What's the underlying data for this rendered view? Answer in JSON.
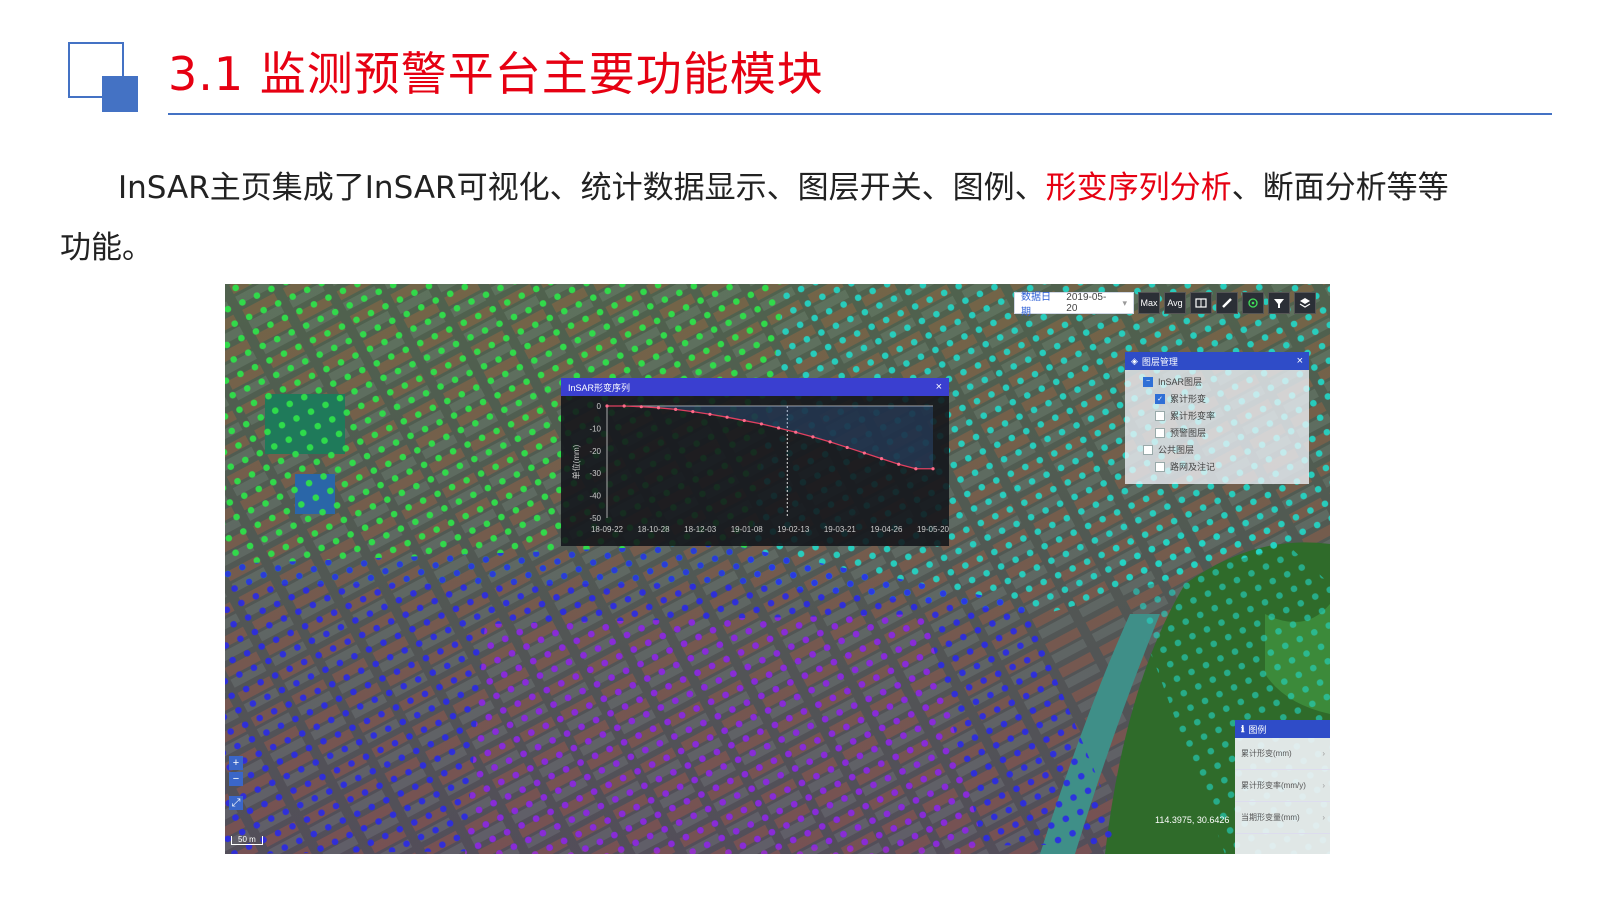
{
  "slide": {
    "title": "3.1 监测预警平台主要功能模块",
    "para_before": "InSAR主页集成了InSAR可视化、统计数据显示、图层开关、图例、",
    "para_highlight": "形变序列分析",
    "para_after": "、断面分析等等功能。"
  },
  "toolbar": {
    "date_label": "数据日期",
    "date_value": "2019-05-20",
    "buttons": [
      "Max",
      "Avg"
    ]
  },
  "layer_panel": {
    "title": "图层管理",
    "items": [
      {
        "label": "InSAR图层",
        "checked": false
      },
      {
        "label": "累计形变",
        "checked": true
      },
      {
        "label": "累计形变率",
        "checked": false
      },
      {
        "label": "预警图层",
        "checked": false
      },
      {
        "label": "公共图层",
        "checked": false
      },
      {
        "label": "路网及注记",
        "checked": false
      }
    ]
  },
  "chart_window": {
    "title": "InSAR形变序列"
  },
  "chart_data": {
    "type": "line",
    "title": "",
    "xlabel": "",
    "ylabel": "单位(mm)",
    "x_tick_labels": [
      "18-09-22",
      "18-10-28",
      "18-12-03",
      "19-01-08",
      "19-02-13",
      "19-03-21",
      "19-04-26",
      "19-05-20"
    ],
    "y_ticks": [
      0,
      -10,
      -20,
      -30,
      -40,
      -50
    ],
    "ylim": [
      -50,
      0
    ],
    "series": [
      {
        "values": [
          0,
          0,
          -0.3,
          -0.8,
          -1.5,
          -2.5,
          -3.7,
          -5.0,
          -6.5,
          -8.0,
          -9.8,
          -11.7,
          -13.8,
          -16.0,
          -18.5,
          -21.0,
          -23.5,
          -26.0,
          -28.0,
          -28.0
        ]
      }
    ],
    "grid": false
  },
  "legend_panel": {
    "title": "图例",
    "items": [
      "累计形变(mm)",
      "累计形变率(mm/y)",
      "当期形变量(mm)"
    ]
  },
  "map": {
    "coords": "114.3975, 30.6426",
    "scale_label": "50 m"
  },
  "colors": {
    "title_red": "#e60012",
    "accent_blue": "#4472c4"
  }
}
